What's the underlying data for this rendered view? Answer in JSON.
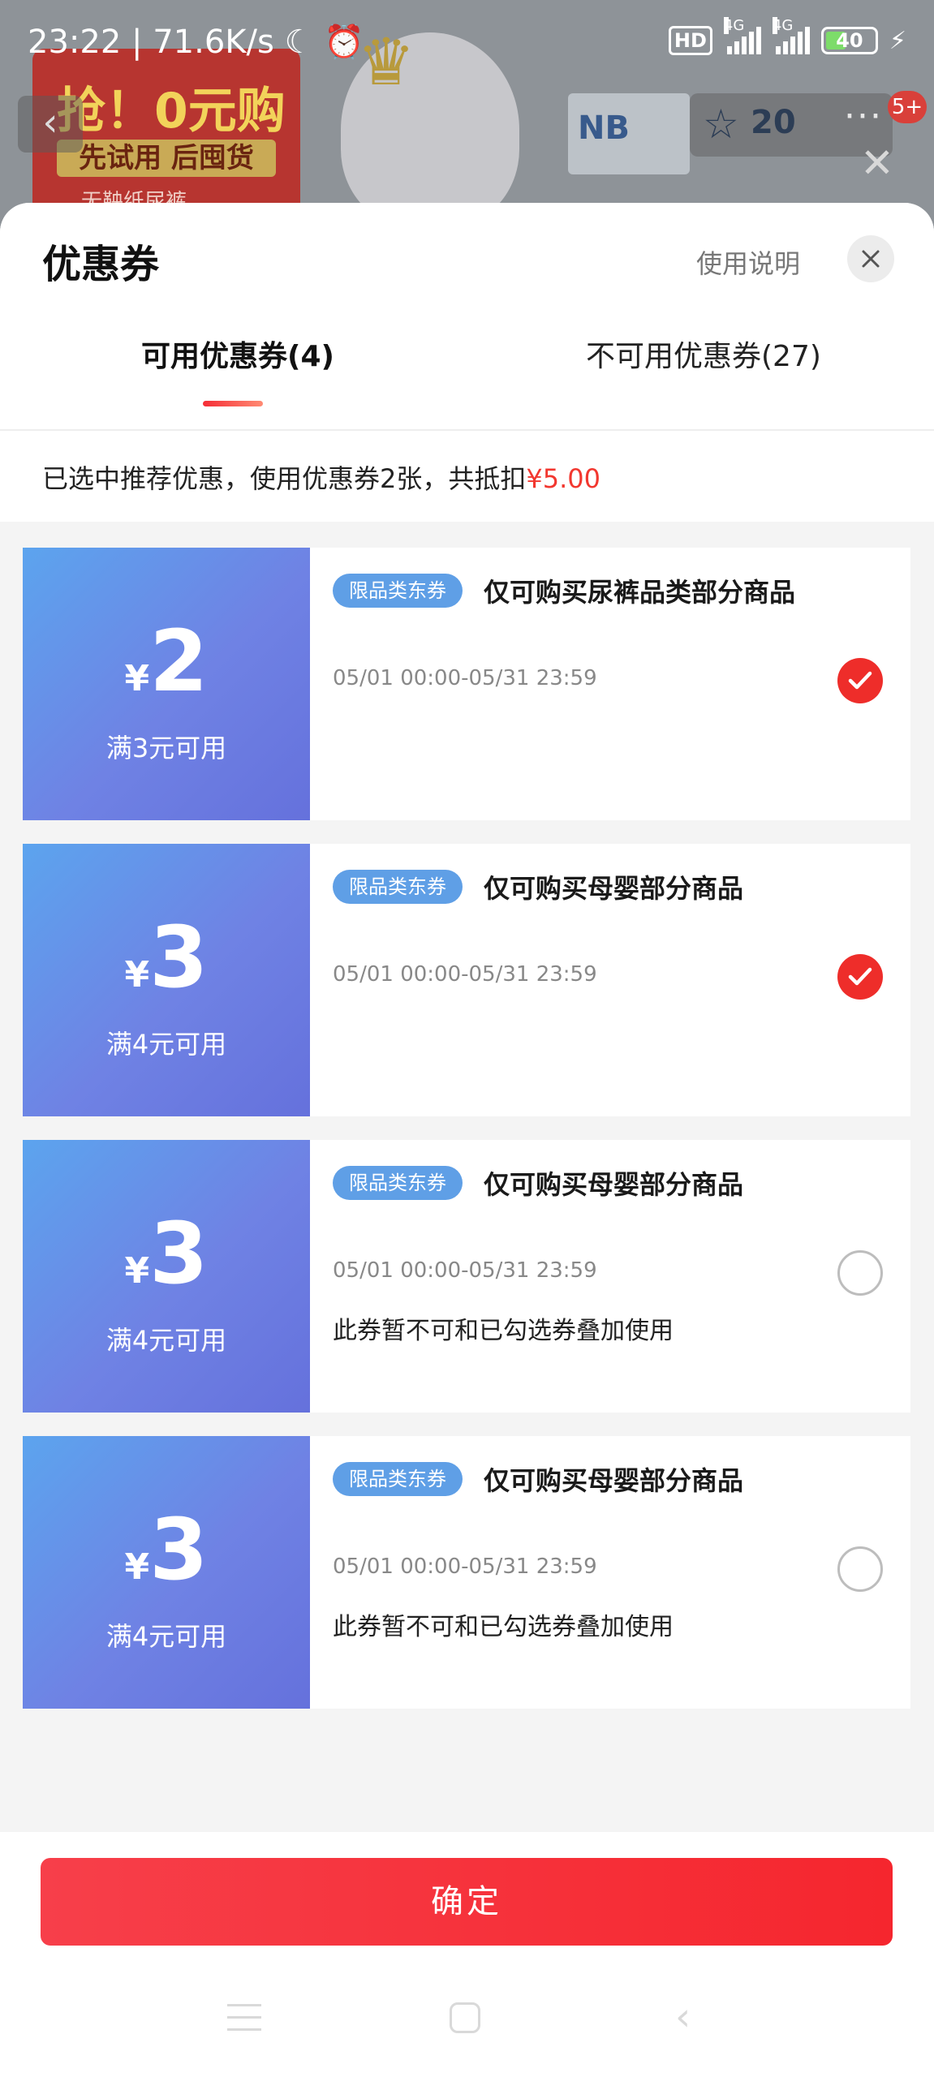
{
  "status_bar": {
    "time": "23:22",
    "speed": "71.6K/s",
    "hd": "HD",
    "net1": "4G",
    "net2": "4G",
    "battery": "40"
  },
  "background": {
    "banner_title": "抢！0元购",
    "banner_sub": "先试用 后囤货",
    "banner_small": "无鞅纸尿裤",
    "nb_text": "NB",
    "count": "20",
    "badge": "5+"
  },
  "sheet": {
    "title": "优惠券",
    "usage_link": "使用说明",
    "tabs": [
      {
        "label": "可用优惠券(4)"
      },
      {
        "label": "不可用优惠券(27)"
      }
    ],
    "summary": {
      "text": "已选中推荐优惠，使用优惠券2张，共抵扣",
      "amount": "¥5.00"
    }
  },
  "coupons": [
    {
      "symbol": "¥",
      "value": "2",
      "threshold": "满3元可用",
      "tag": "限品类东券",
      "scope": "仅可购买尿裤品类部分商品",
      "date": "05/01 00:00-05/31 23:59",
      "note": "",
      "selected": true
    },
    {
      "symbol": "¥",
      "value": "3",
      "threshold": "满4元可用",
      "tag": "限品类东券",
      "scope": "仅可购买母婴部分商品",
      "date": "05/01 00:00-05/31 23:59",
      "note": "",
      "selected": true
    },
    {
      "symbol": "¥",
      "value": "3",
      "threshold": "满4元可用",
      "tag": "限品类东券",
      "scope": "仅可购买母婴部分商品",
      "date": "05/01 00:00-05/31 23:59",
      "note": "此券暂不可和已勾选券叠加使用",
      "selected": false
    },
    {
      "symbol": "¥",
      "value": "3",
      "threshold": "满4元可用",
      "tag": "限品类东券",
      "scope": "仅可购买母婴部分商品",
      "date": "05/01 00:00-05/31 23:59",
      "note": "此券暂不可和已勾选券叠加使用",
      "selected": false
    }
  ],
  "footer": {
    "confirm_label": "确定"
  },
  "colors": {
    "accent_red": "#ee2d2a",
    "coupon_blue_start": "#5ca4ee",
    "coupon_blue_end": "#6571dc",
    "tag_blue": "#5f9fe6"
  },
  "icons": [
    "close-icon",
    "check-icon",
    "radio-empty-icon",
    "alarm-icon",
    "moon-icon",
    "signal-icon",
    "battery-icon",
    "charging-icon",
    "back-arrow-icon",
    "star-icon",
    "more-icon",
    "nav-menu-icon",
    "nav-home-icon",
    "nav-back-icon"
  ]
}
